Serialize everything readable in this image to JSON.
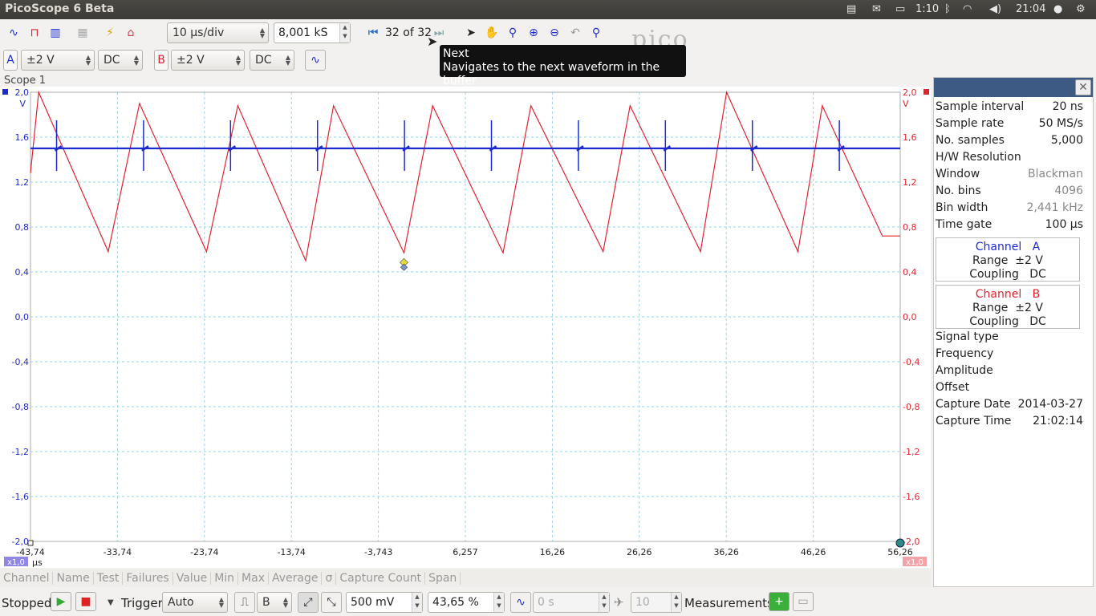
{
  "app": {
    "title": "PicoScope 6 Beta"
  },
  "system_tray": {
    "battery_text": "1:10",
    "clock": "21:04"
  },
  "toolbar": {
    "timebase": "10 µs/div",
    "samples": "8,001 kS",
    "buffer_position": "32 of 32"
  },
  "channels_bar": {
    "a": {
      "letter": "A",
      "range": "±2 V",
      "coupling": "DC",
      "color": "#1c2bd0"
    },
    "b": {
      "letter": "B",
      "range": "±2 V",
      "coupling": "DC",
      "color": "#e2232d"
    }
  },
  "tooltip": {
    "title": "Next",
    "description": "Navigates to the next waveform in the buffer"
  },
  "scope": {
    "title": "Scope 1",
    "y_ticks_left": [
      "2,0",
      "1,6",
      "1,2",
      "0,8",
      "0,4",
      "0,0",
      "-0,4",
      "-0,8",
      "-1,2",
      "-1,6",
      "-2,0"
    ],
    "y_ticks_right": [
      "2,0",
      "1,6",
      "1,2",
      "0,8",
      "0,4",
      "0,0",
      "-0,4",
      "-0,8",
      "-1,2",
      "-1,6",
      "-2,0"
    ],
    "y_unit_left": "V",
    "y_unit_right": "V",
    "x_ticks": [
      "-43,74",
      "-33,74",
      "-23,74",
      "-13,74",
      "-3,743",
      "6,257",
      "16,26",
      "26,26",
      "36,26",
      "46,26",
      "56,26"
    ],
    "x_unit": "µs",
    "zoom_left": "x1,0",
    "zoom_right": "x1,0"
  },
  "chart_data": {
    "type": "line",
    "x_range": [
      -43.74,
      56.26
    ],
    "y_range": [
      -2.0,
      2.0
    ],
    "series": [
      {
        "name": "Channel A",
        "color": "#1c2bd0",
        "baseline": 1.5,
        "spike_x": [
          -40.74,
          -30.74,
          -20.74,
          -10.74,
          -0.74,
          9.26,
          19.26,
          29.26,
          39.26,
          49.26
        ]
      },
      {
        "name": "Channel B",
        "color": "#e2232d",
        "peaks": [
          [
            -42.8,
            2.0
          ],
          [
            -31.2,
            1.9
          ],
          [
            -19.9,
            1.88
          ],
          [
            -8.9,
            1.88
          ],
          [
            2.5,
            1.88
          ],
          [
            13.8,
            1.88
          ],
          [
            25.2,
            1.88
          ],
          [
            36.3,
            2.0
          ],
          [
            47.3,
            1.88
          ]
        ],
        "troughs": [
          [
            -34.8,
            0.58
          ],
          [
            -23.5,
            0.58
          ],
          [
            -12.1,
            0.5
          ],
          [
            -0.8,
            0.57
          ],
          [
            10.6,
            0.57
          ],
          [
            22.1,
            0.58
          ],
          [
            33.3,
            0.58
          ],
          [
            44.5,
            0.58
          ],
          [
            54.2,
            0.72
          ]
        ]
      }
    ]
  },
  "properties": {
    "rows_top": [
      {
        "label": "Sample interval",
        "value": "20 ns"
      },
      {
        "label": "Sample rate",
        "value": "50 MS/s"
      },
      {
        "label": "No. samples",
        "value": "5,000"
      },
      {
        "label": "H/W Resolution",
        "value": ""
      },
      {
        "label": "Window",
        "value": "Blackman"
      },
      {
        "label": "No. bins",
        "value": "4096"
      },
      {
        "label": "Bin width",
        "value": "2,441 kHz"
      },
      {
        "label": "Time gate",
        "value": "100 µs"
      }
    ],
    "channel_a": {
      "label": "Channel",
      "letter": "A",
      "range_label": "Range",
      "range": "±2 V",
      "coupling_label": "Coupling",
      "coupling": "DC"
    },
    "channel_b": {
      "label": "Channel",
      "letter": "B",
      "range_label": "Range",
      "range": "±2 V",
      "coupling_label": "Coupling",
      "coupling": "DC"
    },
    "rows_bottom": [
      {
        "label": "Signal type",
        "value": ""
      },
      {
        "label": "Frequency",
        "value": ""
      },
      {
        "label": "Amplitude",
        "value": ""
      },
      {
        "label": "Offset",
        "value": ""
      },
      {
        "label": "Capture Date",
        "value": "2014-03-27"
      },
      {
        "label": "Capture Time",
        "value": "21:02:14"
      }
    ]
  },
  "measurements_header": [
    "Channel",
    "Name",
    "Test",
    "Failures",
    "Value",
    "Min",
    "Max",
    "Average",
    "σ",
    "Capture Count",
    "Span"
  ],
  "bottom": {
    "status": "Stopped",
    "trigger_label": "Trigger",
    "trigger_mode": "Auto",
    "trigger_channel": "B",
    "threshold": "500 mV",
    "pre_trigger": "43,65 %",
    "delay": "0 s",
    "count": "10",
    "measurements_label": "Measurements"
  }
}
